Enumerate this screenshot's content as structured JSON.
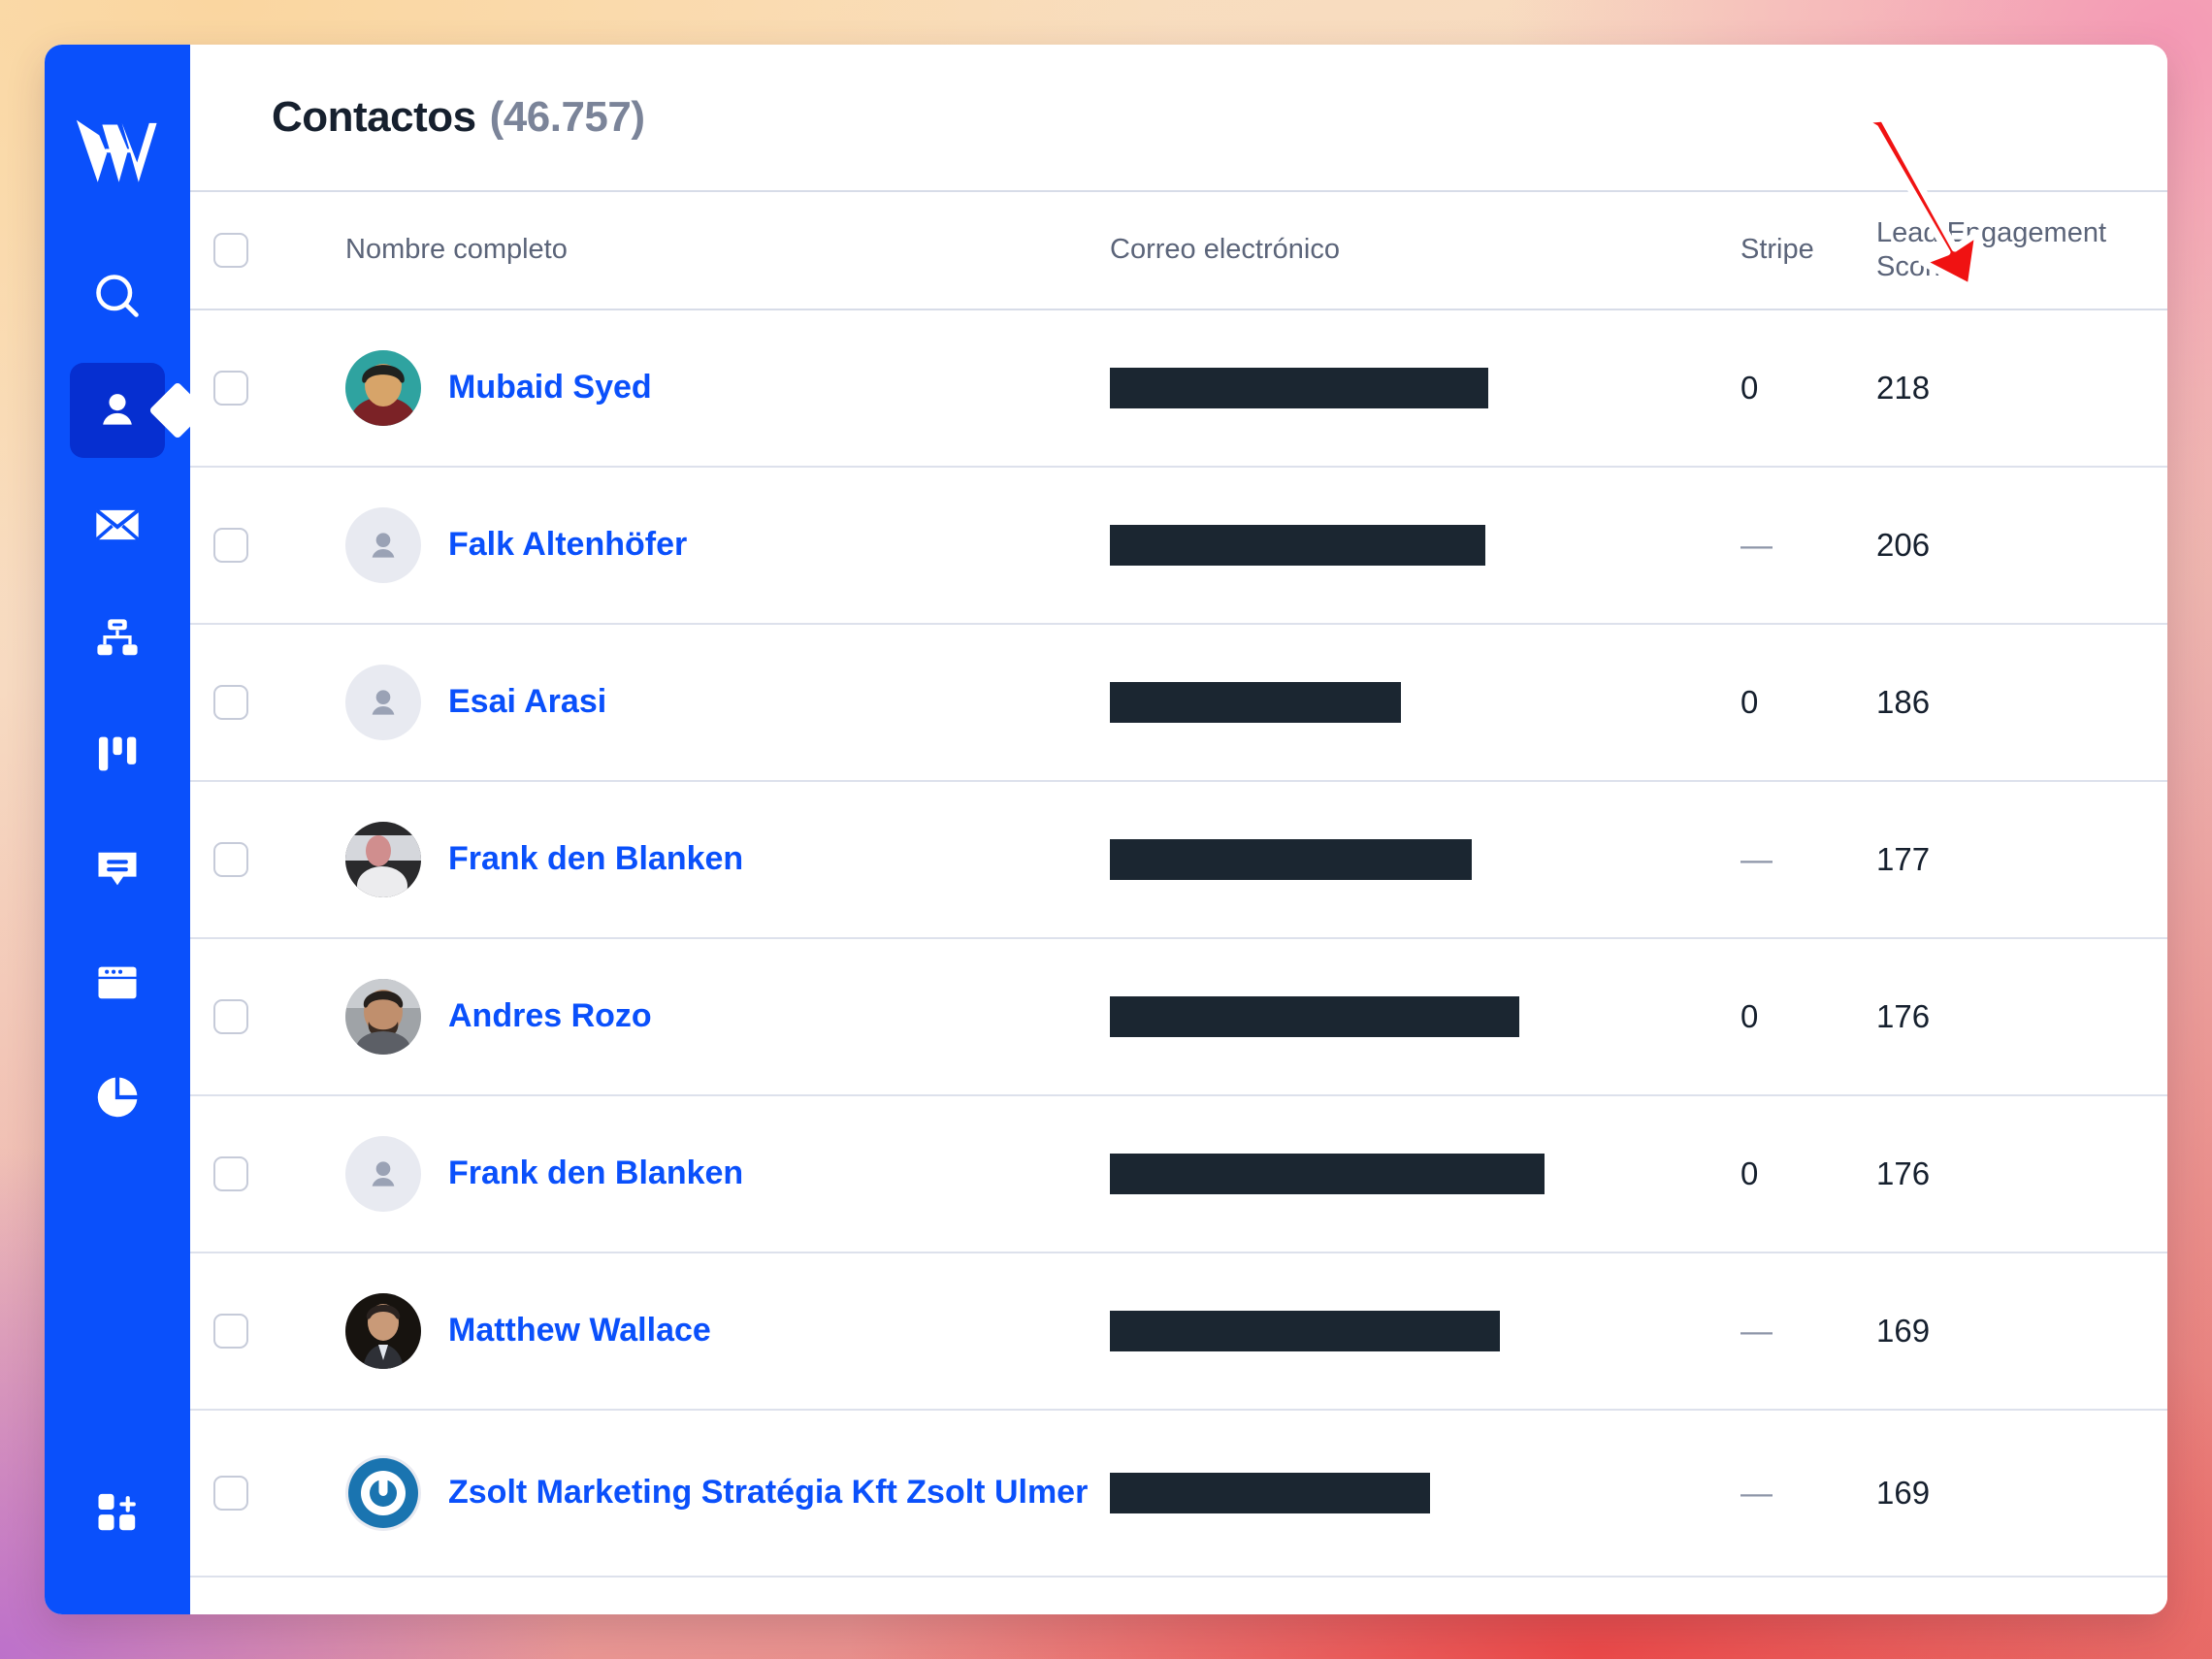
{
  "brand": {
    "logo_name": "woodpecker-w-logo",
    "sidebar_color": "#0a50fb",
    "sidebar_active_color": "#062fd0",
    "link_color": "#0a50fb",
    "redaction_color": "#1b2631",
    "annotation_color": "#f01212"
  },
  "sidebar": {
    "items": [
      {
        "name": "search",
        "icon": "search-icon",
        "active": false
      },
      {
        "name": "contacts",
        "icon": "person-icon",
        "active": true
      },
      {
        "name": "mail",
        "icon": "envelope-icon",
        "active": false
      },
      {
        "name": "workflows",
        "icon": "sitemap-icon",
        "active": false
      },
      {
        "name": "pipeline",
        "icon": "kanban-icon",
        "active": false
      },
      {
        "name": "messages",
        "icon": "chat-icon",
        "active": false
      },
      {
        "name": "pages",
        "icon": "browser-icon",
        "active": false
      },
      {
        "name": "reports",
        "icon": "pie-chart-icon",
        "active": false
      }
    ],
    "bottom_item": {
      "name": "add-apps",
      "icon": "grid-plus-icon"
    }
  },
  "header": {
    "title": "Contactos",
    "count": "(46.757)"
  },
  "table": {
    "columns": {
      "select": "",
      "name": "Nombre completo",
      "email": "Correo electrónico",
      "stripe": "Stripe",
      "score": "Lead Engagement Scoring"
    },
    "rows": [
      {
        "name": "Mubaid Syed",
        "avatar": "photo-teal",
        "email_redacted_width": 390,
        "stripe": "0",
        "score": "218"
      },
      {
        "name": "Falk Altenhöfer",
        "avatar": "placeholder",
        "email_redacted_width": 387,
        "stripe": "—",
        "score": "206"
      },
      {
        "name": "Esai Arasi",
        "avatar": "placeholder",
        "email_redacted_width": 300,
        "stripe": "0",
        "score": "186"
      },
      {
        "name": "Frank den Blanken",
        "avatar": "photo-pink",
        "email_redacted_width": 373,
        "stripe": "—",
        "score": "177"
      },
      {
        "name": "Andres Rozo",
        "avatar": "photo-face",
        "email_redacted_width": 422,
        "stripe": "0",
        "score": "176"
      },
      {
        "name": "Frank den Blanken",
        "avatar": "placeholder",
        "email_redacted_width": 448,
        "stripe": "0",
        "score": "176"
      },
      {
        "name": "Matthew Wallace",
        "avatar": "photo-dark",
        "email_redacted_width": 402,
        "stripe": "—",
        "score": "169"
      },
      {
        "name": "Zsolt Marketing Stratégia Kft Zsolt Ulmer",
        "avatar": "logo-blue",
        "email_redacted_width": 330,
        "stripe": "—",
        "score": "169"
      }
    ]
  },
  "annotation": {
    "type": "red-arrow",
    "points_to": "Lead Engagement Scoring",
    "direction": "down-right"
  }
}
